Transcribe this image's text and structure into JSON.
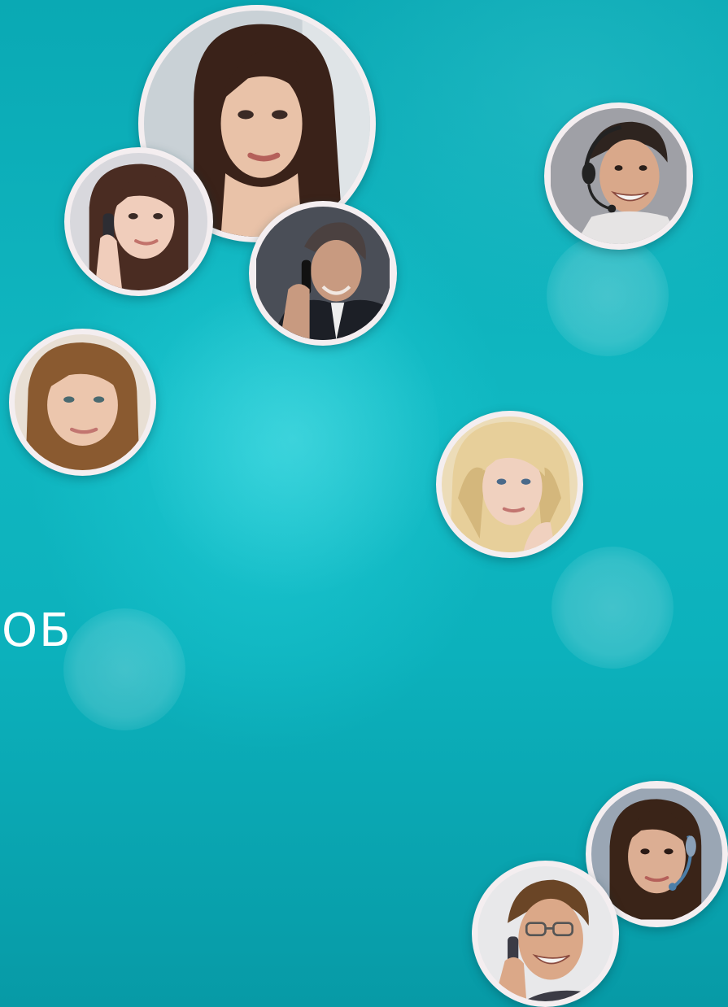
{
  "headline": "ОБ",
  "avatars": [
    {
      "name": "woman-long-brown-hair-photo",
      "skin": "#e9c2a8",
      "hair": "#3a2219",
      "bg": "#c9d1d6",
      "accent": "#5b3a30"
    },
    {
      "name": "girl-on-phone-photo",
      "skin": "#f0cdbb",
      "hair": "#4a2c22",
      "bg": "#d8d8dd",
      "accent": "#2d2d33"
    },
    {
      "name": "man-on-phone-suit-photo",
      "skin": "#c89a80",
      "hair": "#4b4140",
      "bg": "#4a4e57",
      "accent": "#1c1f26"
    },
    {
      "name": "man-with-headset-photo",
      "skin": "#d9a88a",
      "hair": "#2e241f",
      "bg": "#9fa0a6",
      "accent": "#e6e4e4"
    },
    {
      "name": "woman-auburn-hair-photo",
      "skin": "#ecc6ad",
      "hair": "#8a5a30",
      "bg": "#e8dfd4",
      "accent": "#6b4424"
    },
    {
      "name": "blonde-woman-photo",
      "skin": "#f0d1bf",
      "hair": "#e7cf9a",
      "bg": "#ecdcb8",
      "accent": "#d4b77c"
    },
    {
      "name": "woman-with-headset-photo",
      "skin": "#dcae93",
      "hair": "#3a2418",
      "bg": "#9aa6b4",
      "accent": "#4c7ea8"
    },
    {
      "name": "man-with-glasses-on-phone-photo",
      "skin": "#dba888",
      "hair": "#6a4526",
      "bg": "#e8e8ea",
      "accent": "#3b3b45"
    }
  ]
}
